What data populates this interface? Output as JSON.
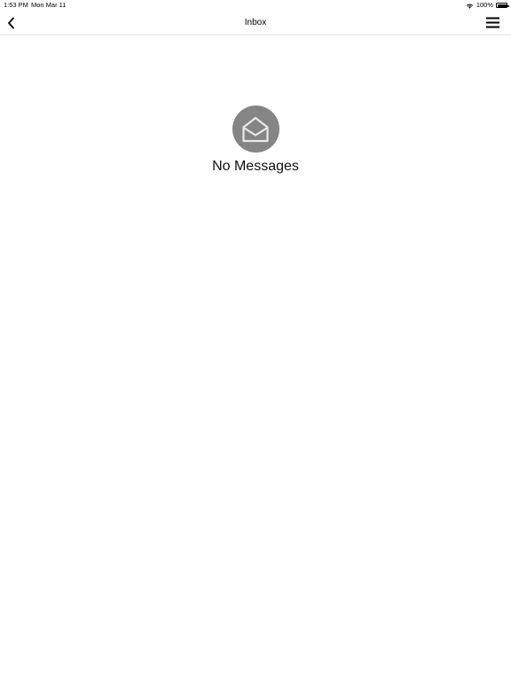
{
  "status_bar": {
    "time": "1:53 PM",
    "date": "Mon Mar 11",
    "battery_percent": "100%",
    "wifi_icon": "wifi-icon",
    "battery_icon": "battery-icon"
  },
  "nav": {
    "title": "Inbox",
    "back_icon": "chevron-left-icon",
    "menu_icon": "hamburger-menu-icon"
  },
  "empty_state": {
    "icon": "open-envelope-icon",
    "message": "No Messages"
  },
  "colors": {
    "background": "#ffffff",
    "icon_circle": "#858585",
    "divider": "#e2e2e2"
  }
}
